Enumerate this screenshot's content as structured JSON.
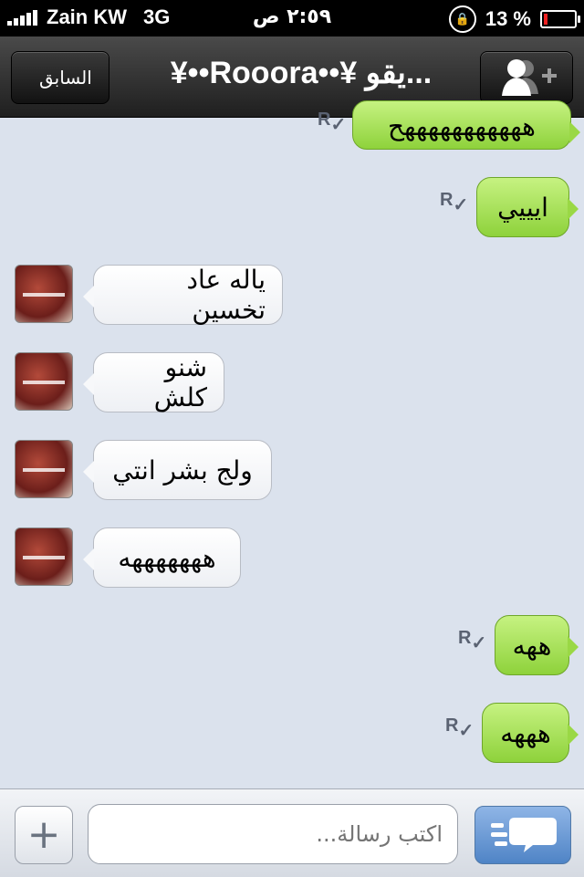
{
  "status_bar": {
    "carrier": "Zain KW",
    "network": "3G",
    "time": "٢:٥٩ ص",
    "battery_percent": "13 %"
  },
  "nav": {
    "back_label": "السابق",
    "title": "¥••Rooora••¥ يقو...",
    "add_contact_icon": "add-contact-icon"
  },
  "messages": [
    {
      "direction": "out",
      "text": "هههههههههههح",
      "receipt": "R"
    },
    {
      "direction": "out",
      "text": "ايييي",
      "receipt": "R"
    },
    {
      "direction": "in",
      "text": "ياله عاد تخسين"
    },
    {
      "direction": "in",
      "text": "شنو كلش"
    },
    {
      "direction": "in",
      "text": "ولج بشر انتي"
    },
    {
      "direction": "in",
      "text": "هههههههه"
    },
    {
      "direction": "out",
      "text": "ههه",
      "receipt": "R"
    },
    {
      "direction": "out",
      "text": "هههه",
      "receipt": "R"
    }
  ],
  "composer": {
    "placeholder": "اكتب رسالة...",
    "add_icon": "plus-icon",
    "send_icon": "send-icon"
  },
  "colors": {
    "outgoing_bubble": "#9ad845",
    "incoming_bubble": "#ffffff",
    "background": "#dbe2ed",
    "send_button": "#5a8fd0"
  }
}
